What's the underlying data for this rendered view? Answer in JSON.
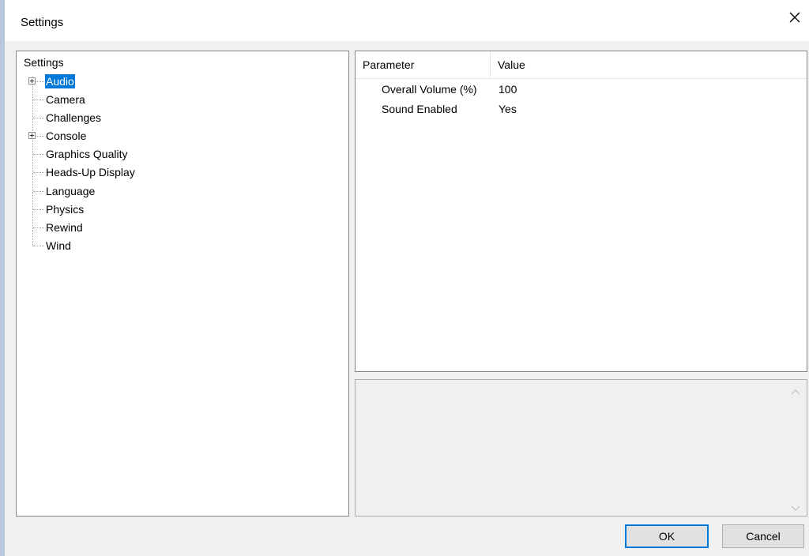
{
  "window": {
    "title": "Settings",
    "close_icon": "close-icon",
    "accent_color": "#0078d7"
  },
  "tree": {
    "root_label": "Settings",
    "items": [
      {
        "label": "Audio",
        "expandable": true,
        "selected": true
      },
      {
        "label": "Camera",
        "expandable": false,
        "selected": false
      },
      {
        "label": "Challenges",
        "expandable": false,
        "selected": false
      },
      {
        "label": "Console",
        "expandable": true,
        "selected": false
      },
      {
        "label": "Graphics Quality",
        "expandable": false,
        "selected": false
      },
      {
        "label": "Heads-Up Display",
        "expandable": false,
        "selected": false
      },
      {
        "label": "Language",
        "expandable": false,
        "selected": false
      },
      {
        "label": "Physics",
        "expandable": false,
        "selected": false
      },
      {
        "label": "Rewind",
        "expandable": false,
        "selected": false
      },
      {
        "label": "Wind",
        "expandable": false,
        "selected": false
      }
    ]
  },
  "grid": {
    "columns": [
      "Parameter",
      "Value"
    ],
    "rows": [
      {
        "parameter": "Overall Volume (%)",
        "value": "100"
      },
      {
        "parameter": "Sound Enabled",
        "value": "Yes"
      }
    ]
  },
  "buttons": {
    "ok_label": "OK",
    "cancel_label": "Cancel"
  }
}
